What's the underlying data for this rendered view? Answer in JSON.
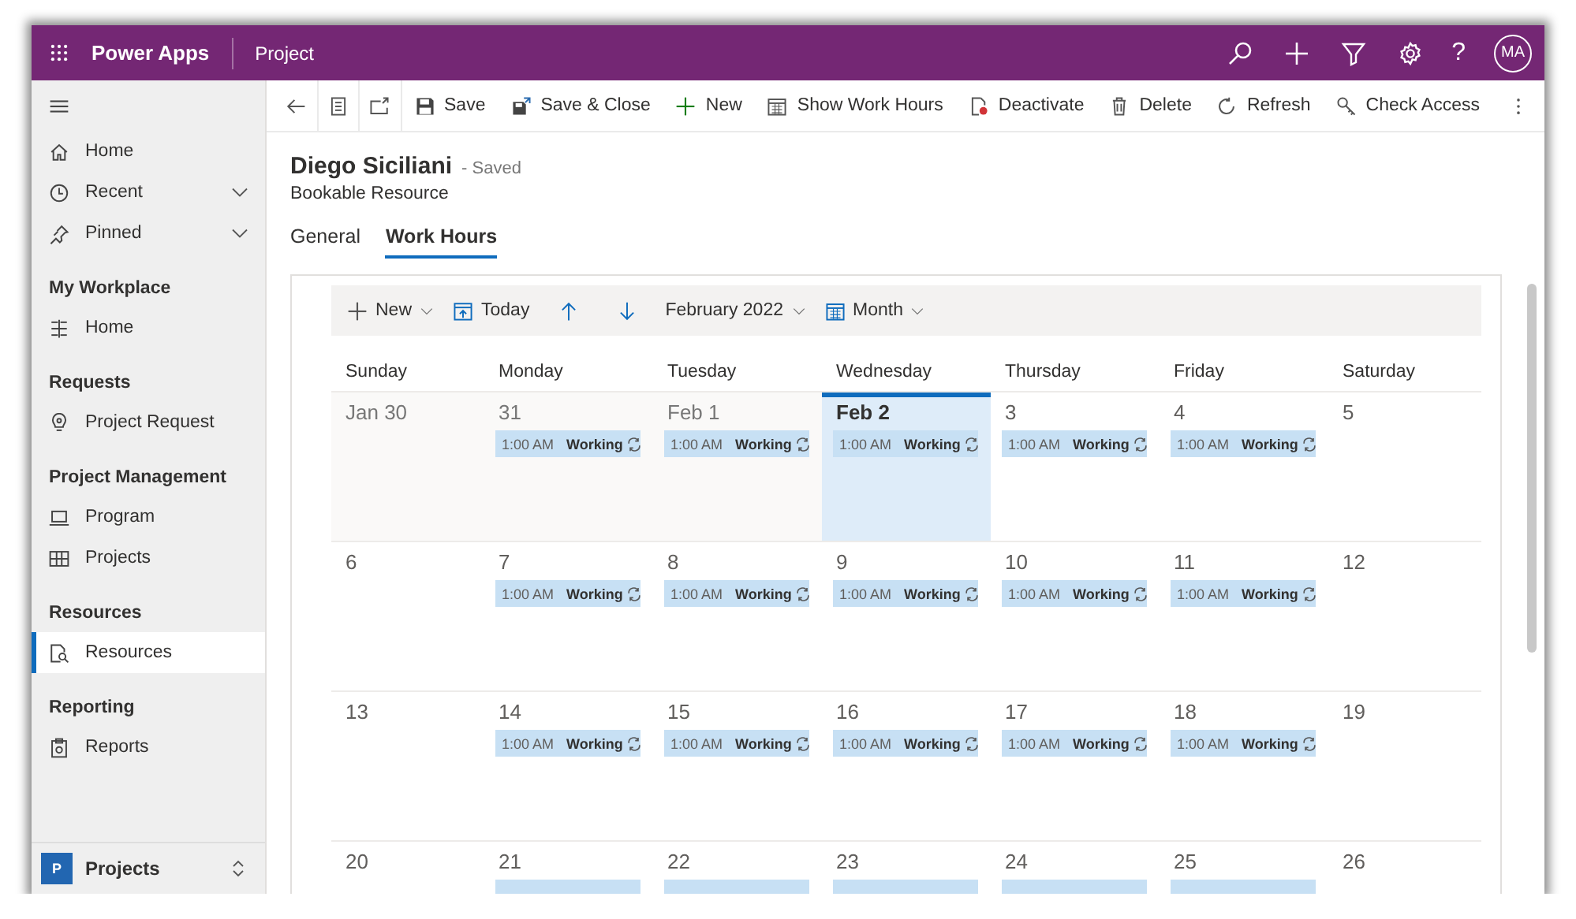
{
  "header": {
    "app_name": "Power Apps",
    "area": "Project",
    "help": "?",
    "avatar": "MA"
  },
  "command_bar": [
    {
      "kind": "icon"
    },
    {
      "kind": "icon"
    },
    {
      "kind": "icon"
    },
    {
      "kind": "button",
      "label": "Save"
    },
    {
      "kind": "button",
      "label": "Save & Close"
    },
    {
      "kind": "button",
      "label": "New"
    },
    {
      "kind": "button",
      "label": "Show Work Hours"
    },
    {
      "kind": "button",
      "label": "Deactivate"
    },
    {
      "kind": "button",
      "label": "Delete"
    },
    {
      "kind": "button",
      "label": "Refresh"
    },
    {
      "kind": "button",
      "label": "Check Access"
    },
    {
      "kind": "more"
    }
  ],
  "sidebar": {
    "top_items": [
      {
        "label": "Home",
        "selected": false
      },
      {
        "label": "Recent",
        "expanded": false,
        "selected": false
      },
      {
        "label": "Pinned",
        "expanded": false,
        "selected": false
      }
    ],
    "sections": [
      {
        "title": "My Workplace",
        "items": [
          {
            "label": "Home",
            "selected": false
          }
        ]
      },
      {
        "title": "Requests",
        "items": [
          {
            "label": "Project Request",
            "selected": false
          }
        ]
      },
      {
        "title": "Project Management",
        "items": [
          {
            "label": "Program",
            "selected": false
          },
          {
            "label": "Projects",
            "selected": false
          }
        ]
      },
      {
        "title": "Resources",
        "items": [
          {
            "label": "Resources",
            "selected": true
          }
        ]
      },
      {
        "title": "Reporting",
        "items": [
          {
            "label": "Reports",
            "selected": false
          }
        ]
      }
    ],
    "area_switcher": {
      "tile": "P",
      "label": "Projects"
    }
  },
  "form": {
    "title": "Diego Siciliani",
    "status": "- Saved",
    "entity": "Bookable Resource",
    "tabs": [
      {
        "label": "General",
        "selected": false
      },
      {
        "label": "Work Hours",
        "selected": true
      }
    ]
  },
  "calendar": {
    "toolbar": {
      "new": "New",
      "today": "Today",
      "period": "February 2022",
      "view": "Month"
    },
    "weekdays": [
      "Sunday",
      "Monday",
      "Tuesday",
      "Wednesday",
      "Thursday",
      "Friday",
      "Saturday"
    ],
    "weeks": [
      [
        {
          "label": "Jan 30",
          "past": true,
          "today": false
        },
        {
          "label": "31",
          "past": true,
          "today": false,
          "events": [
            {
              "kind": "full",
              "time": "1:00 AM",
              "status": "Working"
            }
          ]
        },
        {
          "label": "Feb 1",
          "past": true,
          "today": false,
          "events": [
            {
              "kind": "full",
              "time": "1:00 AM",
              "status": "Working"
            }
          ]
        },
        {
          "label": "Feb 2",
          "past": false,
          "today": true,
          "events": [
            {
              "kind": "full",
              "time": "1:00 AM",
              "status": "Working"
            }
          ]
        },
        {
          "label": "3",
          "past": false,
          "today": false,
          "events": [
            {
              "kind": "full",
              "time": "1:00 AM",
              "status": "Working"
            }
          ]
        },
        {
          "label": "4",
          "past": false,
          "today": false,
          "events": [
            {
              "kind": "full",
              "time": "1:00 AM",
              "status": "Working"
            }
          ]
        },
        {
          "label": "5",
          "past": false,
          "today": false
        }
      ],
      [
        {
          "label": "6",
          "past": false,
          "today": false
        },
        {
          "label": "7",
          "past": false,
          "today": false,
          "events": [
            {
              "kind": "full",
              "time": "1:00 AM",
              "status": "Working"
            }
          ]
        },
        {
          "label": "8",
          "past": false,
          "today": false,
          "events": [
            {
              "kind": "full",
              "time": "1:00 AM",
              "status": "Working"
            }
          ]
        },
        {
          "label": "9",
          "past": false,
          "today": false,
          "events": [
            {
              "kind": "full",
              "time": "1:00 AM",
              "status": "Working"
            }
          ]
        },
        {
          "label": "10",
          "past": false,
          "today": false,
          "events": [
            {
              "kind": "full",
              "time": "1:00 AM",
              "status": "Working"
            }
          ]
        },
        {
          "label": "11",
          "past": false,
          "today": false,
          "events": [
            {
              "kind": "full",
              "time": "1:00 AM",
              "status": "Working"
            }
          ]
        },
        {
          "label": "12",
          "past": false,
          "today": false
        }
      ],
      [
        {
          "label": "13",
          "past": false,
          "today": false
        },
        {
          "label": "14",
          "past": false,
          "today": false,
          "events": [
            {
              "kind": "full",
              "time": "1:00 AM",
              "status": "Working"
            }
          ]
        },
        {
          "label": "15",
          "past": false,
          "today": false,
          "events": [
            {
              "kind": "full",
              "time": "1:00 AM",
              "status": "Working"
            }
          ]
        },
        {
          "label": "16",
          "past": false,
          "today": false,
          "events": [
            {
              "kind": "full",
              "time": "1:00 AM",
              "status": "Working"
            }
          ]
        },
        {
          "label": "17",
          "past": false,
          "today": false,
          "events": [
            {
              "kind": "full",
              "time": "1:00 AM",
              "status": "Working"
            }
          ]
        },
        {
          "label": "18",
          "past": false,
          "today": false,
          "events": [
            {
              "kind": "full",
              "time": "1:00 AM",
              "status": "Working"
            }
          ]
        },
        {
          "label": "19",
          "past": false,
          "today": false
        }
      ],
      [
        {
          "label": "20",
          "past": false,
          "today": false
        },
        {
          "label": "21",
          "past": false,
          "today": false,
          "events": [
            {
              "kind": "cut"
            }
          ]
        },
        {
          "label": "22",
          "past": false,
          "today": false,
          "events": [
            {
              "kind": "cut"
            }
          ]
        },
        {
          "label": "23",
          "past": false,
          "today": false,
          "events": [
            {
              "kind": "cut"
            }
          ]
        },
        {
          "label": "24",
          "past": false,
          "today": false,
          "events": [
            {
              "kind": "cut"
            }
          ]
        },
        {
          "label": "25",
          "past": false,
          "today": false,
          "events": [
            {
              "kind": "cut"
            }
          ]
        },
        {
          "label": "26",
          "past": false,
          "today": false
        }
      ]
    ]
  }
}
